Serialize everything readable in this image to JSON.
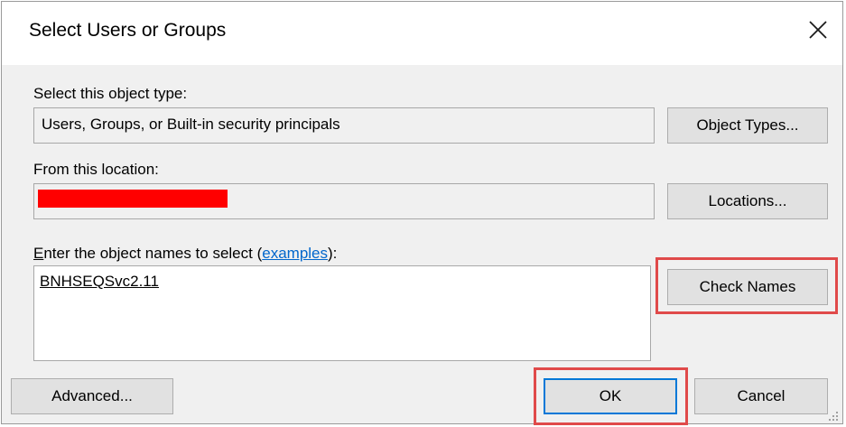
{
  "dialog": {
    "title": "Select Users or Groups",
    "close_glyph": "✕"
  },
  "object_type": {
    "label": "Select this object type:",
    "value": "Users, Groups, or Built-in security principals",
    "button": "Object Types..."
  },
  "location": {
    "label": "From this location:",
    "redaction_color": "#ff0000",
    "button": "Locations..."
  },
  "names": {
    "label_first_letter": "E",
    "label_rest": "nter the object names to select (",
    "link": "examples",
    "label_end": "):",
    "entry": "BNHSEQSvc2.11",
    "check_button": "Check Names"
  },
  "footer": {
    "advanced": "Advanced...",
    "ok": "OK",
    "cancel": "Cancel"
  },
  "colors": {
    "dialog_bg": "#f0f0f0",
    "highlight": "#e04a4a",
    "accent": "#0078d7",
    "link": "#0066cc"
  }
}
